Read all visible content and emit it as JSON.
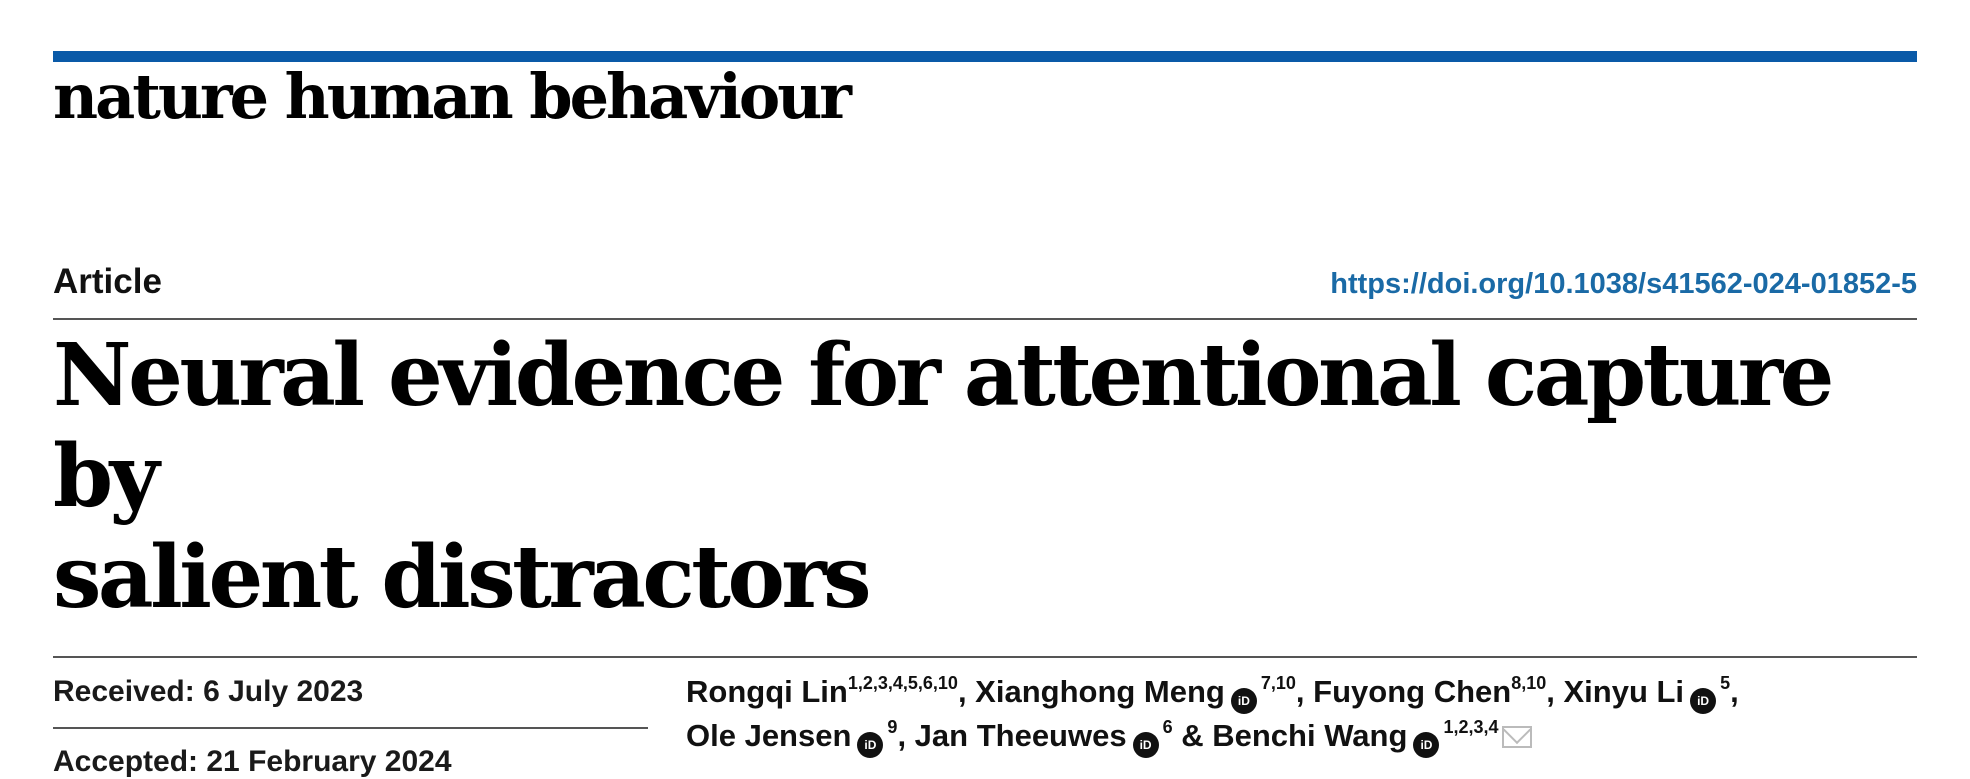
{
  "journal": {
    "name": "nature human behaviour"
  },
  "header": {
    "article_type": "Article",
    "doi": "https://doi.org/10.1038/s41562-024-01852-5"
  },
  "title": {
    "line1": "Neural evidence for attentional capture by",
    "line2": "salient distractors"
  },
  "dates": {
    "received": "Received: 6 July 2023",
    "accepted": "Accepted: 21 February 2024"
  },
  "authors": [
    {
      "name": "Rongqi Lin",
      "sup": "1,2,3,4,5,6,10",
      "orcid": false,
      "sep": ", "
    },
    {
      "name": "Xianghong Meng",
      "sup": "7,10",
      "orcid": true,
      "sep": ", "
    },
    {
      "name": "Fuyong Chen",
      "sup": "8,10",
      "orcid": false,
      "sep": ", "
    },
    {
      "name": "Xinyu Li",
      "sup": "5",
      "orcid": true,
      "sep": ","
    },
    {
      "name": "Ole Jensen",
      "sup": "9",
      "orcid": true,
      "sep": ", "
    },
    {
      "name": "Jan Theeuwes",
      "sup": "6",
      "orcid": true,
      "sep": " & "
    },
    {
      "name": "Benchi Wang",
      "sup": "1,2,3,4",
      "orcid": true,
      "sep": ""
    }
  ],
  "icons": {
    "orcid": "orcid-icon",
    "email": "email-icon"
  },
  "colors": {
    "brand_bar": "#0a5aa8",
    "doi_link": "#1a6aa6"
  }
}
